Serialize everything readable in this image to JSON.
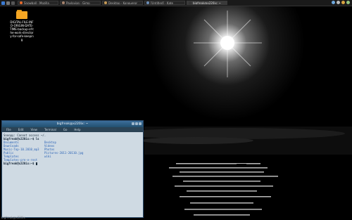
{
  "panel": {
    "tasks": [
      {
        "label": "Snowball - Mozilla",
        "icon": "firefox-icon",
        "color": "#e66a2c",
        "active": false
      },
      {
        "label": "Pavlovian - Gimp",
        "icon": "gimp-icon",
        "color": "#a6826b",
        "active": false
      },
      {
        "label": "Desktop - Konqueror",
        "icon": "folder-icon",
        "color": "#c79a55",
        "active": false
      },
      {
        "label": "[Untitled] - Kate",
        "icon": "kate-icon",
        "color": "#6b8fb8",
        "active": false
      },
      {
        "label": "bigfreak@x220ix: ~",
        "icon": "terminal-icon",
        "color": "#333333",
        "active": true
      }
    ],
    "tray_icons": [
      "network-icon",
      "volume-icon",
      "chat-icon",
      "battery-icon"
    ]
  },
  "desktop": {
    "icon_label": "DIGITAL-FILE-INFO-ORIGIN-DATE-TIME-backup-of-the-work-directory-for-safe-keeping"
  },
  "terminal": {
    "title": "bigfreak@x220ix: ~",
    "menu": [
      "File",
      "Edit",
      "View",
      "Terminal",
      "Go",
      "Help"
    ],
    "lines": [
      {
        "type": "text",
        "text": "Snoopy: Cannot access ~/."
      },
      {
        "type": "prompt",
        "text": "bigfreak@x220ix:~$ ls"
      },
      {
        "type": "cols",
        "a": "Documents",
        "b": "Desktop"
      },
      {
        "type": "cols",
        "a": "Downloads",
        "b": "Videos"
      },
      {
        "type": "cols",
        "a": "Music-Top-10.2010_mp3",
        "b": "Photos"
      },
      {
        "type": "cols",
        "a": "Public",
        "b": "Pictures-2011-20110.jpg"
      },
      {
        "type": "cols",
        "a": "Templates",
        "b": "wiki"
      },
      {
        "type": "text",
        "text": "Templates-pre-e-rest"
      },
      {
        "type": "prompt",
        "text": "bigfreak@x220ix:~$ "
      }
    ]
  },
  "status_bottom": "bigfreak@x220ix"
}
